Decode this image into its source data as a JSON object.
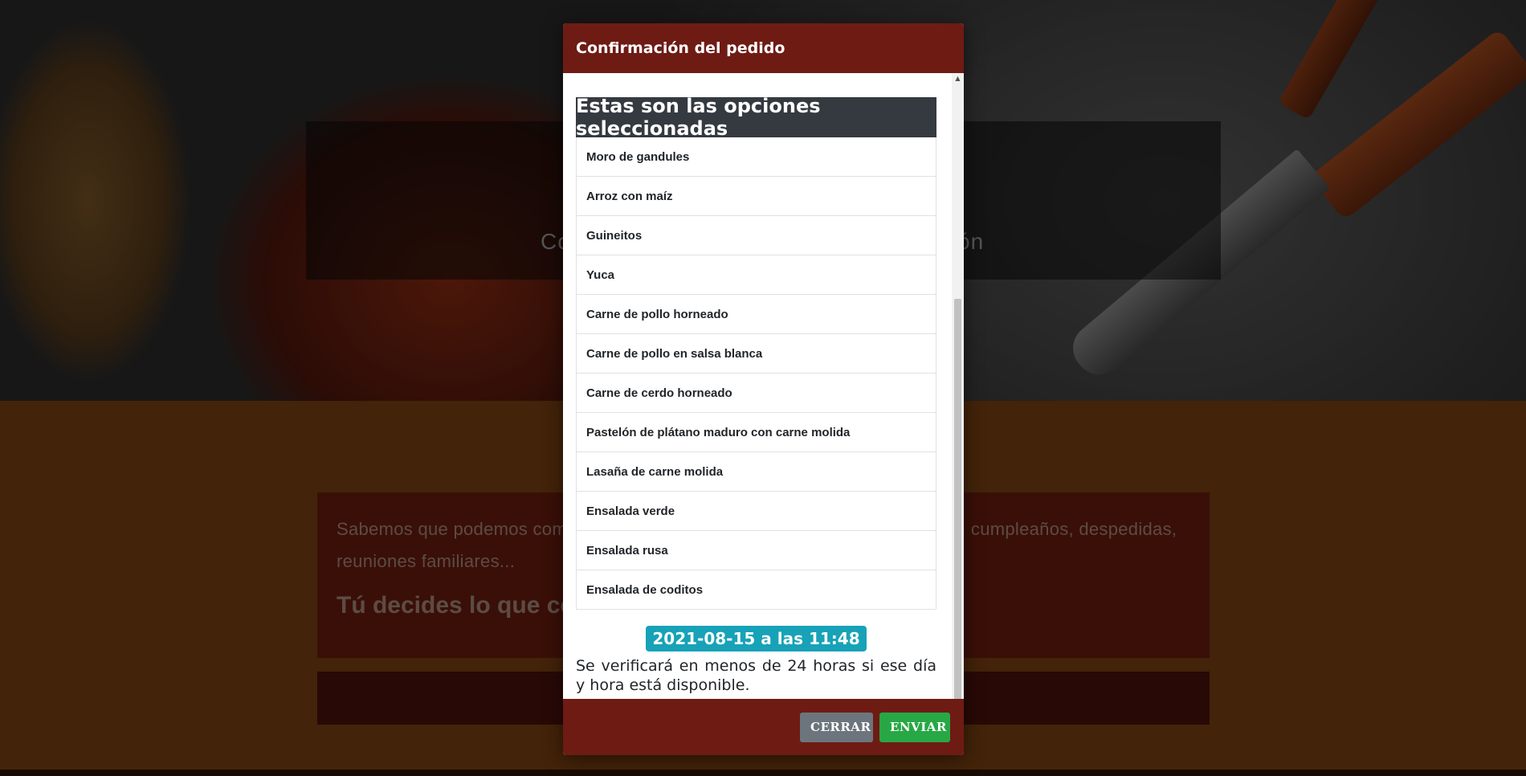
{
  "background": {
    "hero_subtitle_left": "Co",
    "hero_subtitle_right": "ón",
    "section_heading": "",
    "info_text": "Sabemos que podemos complacerte con nuestro servicio de bufé para bodas, cumpleaños, despedidas, reuniones familiares...",
    "info_strong": "Tú decides lo que comer"
  },
  "modal": {
    "title": "Confirmación del pedido",
    "list_header": "Estas son las opciones seleccionadas",
    "items": [
      "Moro de gandules",
      "Arroz con maíz",
      "Guineitos",
      "Yuca",
      "Carne de pollo horneado",
      "Carne de pollo en salsa blanca",
      "Carne de cerdo horneado",
      "Pastelón de plátano maduro con carne molida",
      "Lasaña de carne molida",
      "Ensalada verde",
      "Ensalada rusa",
      "Ensalada de coditos"
    ],
    "date_badge": "2021-08-15 a las 11:48",
    "note": "Se verificará en menos de 24 horas si ese día y hora está disponible.",
    "close_label": "CERRAR",
    "send_label": "ENVIAR"
  },
  "colors": {
    "header_bg": "#6e1b14",
    "list_header_bg": "#343a40",
    "date_badge_bg": "#17a2b8",
    "close_button_bg": "#6c757d",
    "send_button_bg": "#28a745"
  }
}
